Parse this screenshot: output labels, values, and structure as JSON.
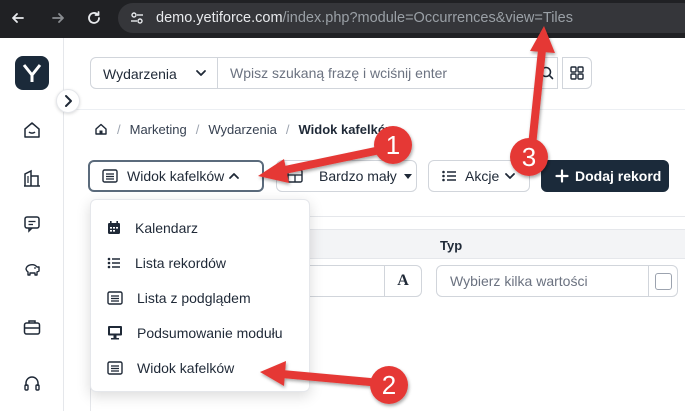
{
  "browser": {
    "url_host": "demo.yetiforce.com",
    "url_path": "/index.php?module=Occurrences&view=Tiles"
  },
  "header": {
    "module_select_value": "Wydarzenia",
    "search_placeholder": "Wpisz szukaną frazę i wciśnij enter"
  },
  "breadcrumb": {
    "items": [
      "Marketing",
      "Wydarzenia"
    ],
    "current": "Widok kafelków"
  },
  "toolbar": {
    "view_button_label": "Widok kafelków",
    "size_button_label": "Bardzo mały",
    "actions_button_label": "Akcje",
    "add_button_label": "Dodaj rekord"
  },
  "table": {
    "column_type_header": "Typ",
    "type_filter_placeholder": "Wybierz kilka wartości",
    "text_filter_icon": "A"
  },
  "view_menu": {
    "items": [
      {
        "label": "Kalendarz",
        "icon": "calendar-icon"
      },
      {
        "label": "Lista rekordów",
        "icon": "list-icon"
      },
      {
        "label": "Lista z podglądem",
        "icon": "list-preview-icon"
      },
      {
        "label": "Podsumowanie modułu",
        "icon": "desktop-icon"
      },
      {
        "label": "Widok kafelków",
        "icon": "tiles-icon"
      }
    ]
  },
  "annotations": {
    "badges": [
      "1",
      "2",
      "3"
    ],
    "color": "#e53935"
  },
  "colors": {
    "brand_dark": "#1b2a3a",
    "annotation_red": "#e53935"
  }
}
